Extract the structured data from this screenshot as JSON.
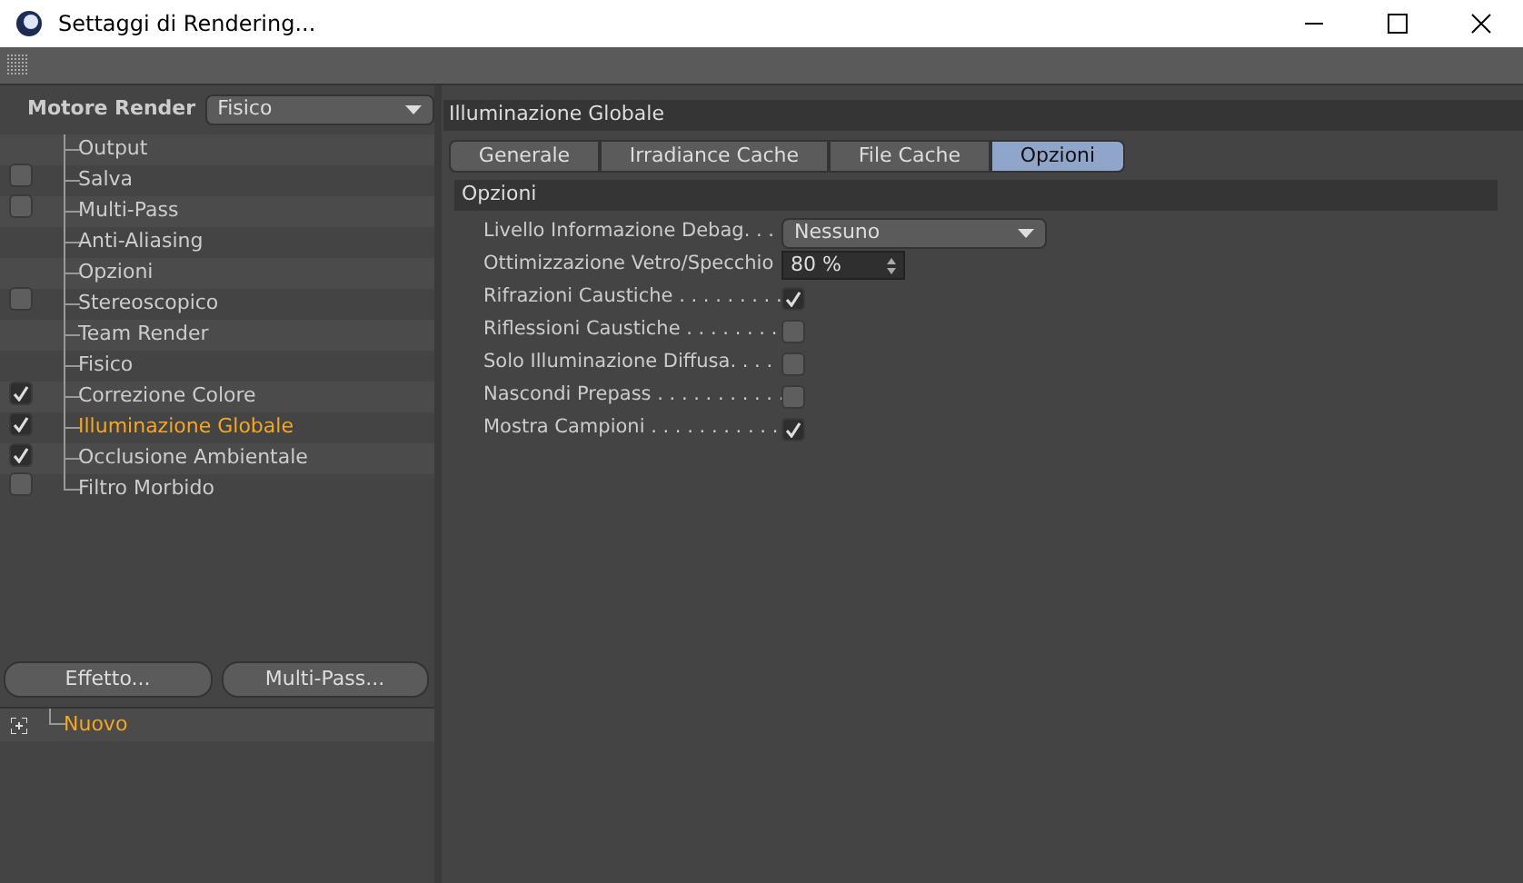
{
  "window": {
    "title": "Settaggi di Rendering..."
  },
  "renderer": {
    "label": "Motore Render",
    "value": "Fisico"
  },
  "sidebar": {
    "items": [
      {
        "label": "Output",
        "kind": "plain",
        "selected": false
      },
      {
        "label": "Salva",
        "kind": "toggle",
        "checked": false,
        "selected": false
      },
      {
        "label": "Multi-Pass",
        "kind": "toggle",
        "checked": false,
        "selected": false
      },
      {
        "label": "Anti-Aliasing",
        "kind": "plain",
        "selected": false
      },
      {
        "label": "Opzioni",
        "kind": "plain",
        "selected": false
      },
      {
        "label": "Stereoscopico",
        "kind": "toggle",
        "checked": false,
        "selected": false
      },
      {
        "label": "Team Render",
        "kind": "plain",
        "selected": false
      },
      {
        "label": "Fisico",
        "kind": "plain",
        "selected": false
      },
      {
        "label": "Correzione Colore",
        "kind": "toggle",
        "checked": true,
        "selected": false
      },
      {
        "label": "Illuminazione Globale",
        "kind": "toggle",
        "checked": true,
        "selected": true
      },
      {
        "label": "Occlusione Ambientale",
        "kind": "toggle",
        "checked": true,
        "selected": false
      },
      {
        "label": "Filtro Morbido",
        "kind": "toggle",
        "checked": false,
        "selected": false
      }
    ]
  },
  "buttons": [
    "Effetto...",
    "Multi-Pass..."
  ],
  "presets": [
    {
      "label": "Nuovo",
      "selected": true
    }
  ],
  "panel": {
    "title": "Illuminazione Globale",
    "tabs": [
      {
        "label": "Generale",
        "selected": false
      },
      {
        "label": "Irradiance Cache",
        "selected": false
      },
      {
        "label": "File Cache",
        "selected": false
      },
      {
        "label": "Opzioni",
        "selected": true
      }
    ],
    "section": "Opzioni",
    "options": [
      {
        "label": "Livello Informazione Debag. . .",
        "kind": "dropdown",
        "value": "Nessuno"
      },
      {
        "label": "Ottimizzazione  Vetro/Specchio",
        "kind": "number",
        "value": "80 %"
      },
      {
        "label": "Rifrazioni Caustiche . . . . . . . . .",
        "kind": "checkbox",
        "checked": true
      },
      {
        "label": "Riflessioni Caustiche . . . . . . . .",
        "kind": "checkbox",
        "checked": false
      },
      {
        "label": "Solo Illuminazione Diffusa. . . .",
        "kind": "checkbox",
        "checked": false
      },
      {
        "label": "Nascondi Prepass . . . . . . . . . . .",
        "kind": "checkbox",
        "checked": false
      },
      {
        "label": "Mostra Campioni . . . . . . . . . . .",
        "kind": "checkbox",
        "checked": true
      }
    ]
  }
}
